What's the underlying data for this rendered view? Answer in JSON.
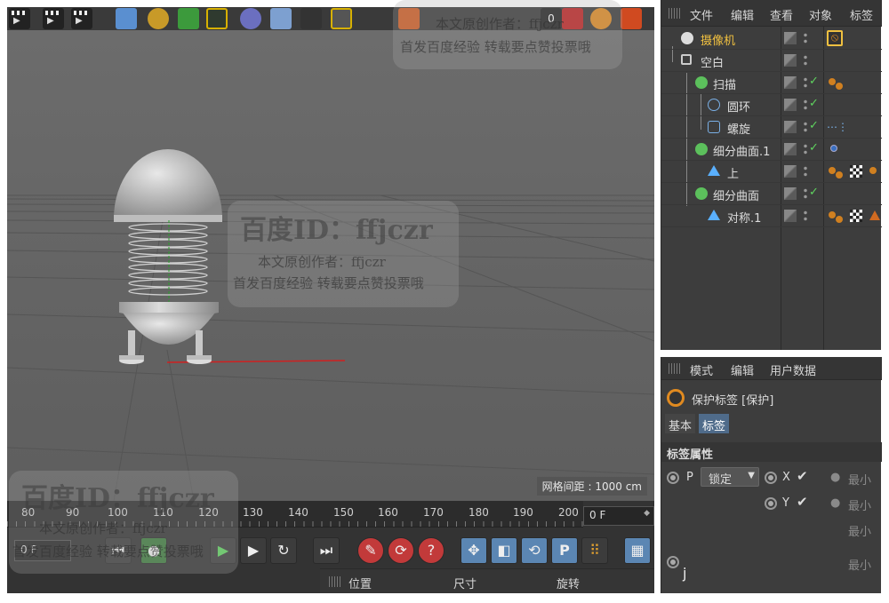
{
  "object_manager": {
    "menu": [
      "文件",
      "编辑",
      "查看",
      "对象",
      "标签"
    ],
    "objects": [
      {
        "name": "摄像机",
        "selected": true,
        "depth": 0
      },
      {
        "name": "空白",
        "depth": 0
      },
      {
        "name": "扫描",
        "depth": 1
      },
      {
        "name": "圆环",
        "depth": 2
      },
      {
        "name": "螺旋",
        "depth": 2
      },
      {
        "name": "细分曲面.1",
        "depth": 1
      },
      {
        "name": "上",
        "depth": 2
      },
      {
        "name": "细分曲面",
        "depth": 1
      },
      {
        "name": "对称.1",
        "depth": 2
      }
    ]
  },
  "attribute_manager": {
    "menu": [
      "模式",
      "编辑",
      "用户数据"
    ],
    "tag_title": "保护标签 [保护]",
    "tabs": [
      "基本",
      "标签"
    ],
    "section": "标签属性",
    "p_label": "P",
    "p_value": "锁定",
    "x_label": "X",
    "y_label": "Y",
    "min_label": "最小",
    "j_label": "j"
  },
  "viewport": {
    "grid_spacing": "网格间距 : 1000 cm"
  },
  "timeline": {
    "ticks": [
      "80",
      "90",
      "100",
      "110",
      "120",
      "130",
      "140",
      "150",
      "160",
      "170",
      "180",
      "190",
      "200"
    ],
    "current_frame": "0 F",
    "start_field": "0 F"
  },
  "coordinates": {
    "labels": [
      "位置",
      "尺寸",
      "旋转"
    ]
  },
  "watermarks": {
    "id_text": "百度ID：ffjczr",
    "author_text": "本文原创作者：ffjczr",
    "note_text": "首发百度经验 转载要点赞投票哦"
  },
  "colors": {
    "selected_text": "#f0c040",
    "active_tab": "#4f6b8a",
    "check_green": "#5fd35f",
    "tag_orange": "#d08020"
  }
}
